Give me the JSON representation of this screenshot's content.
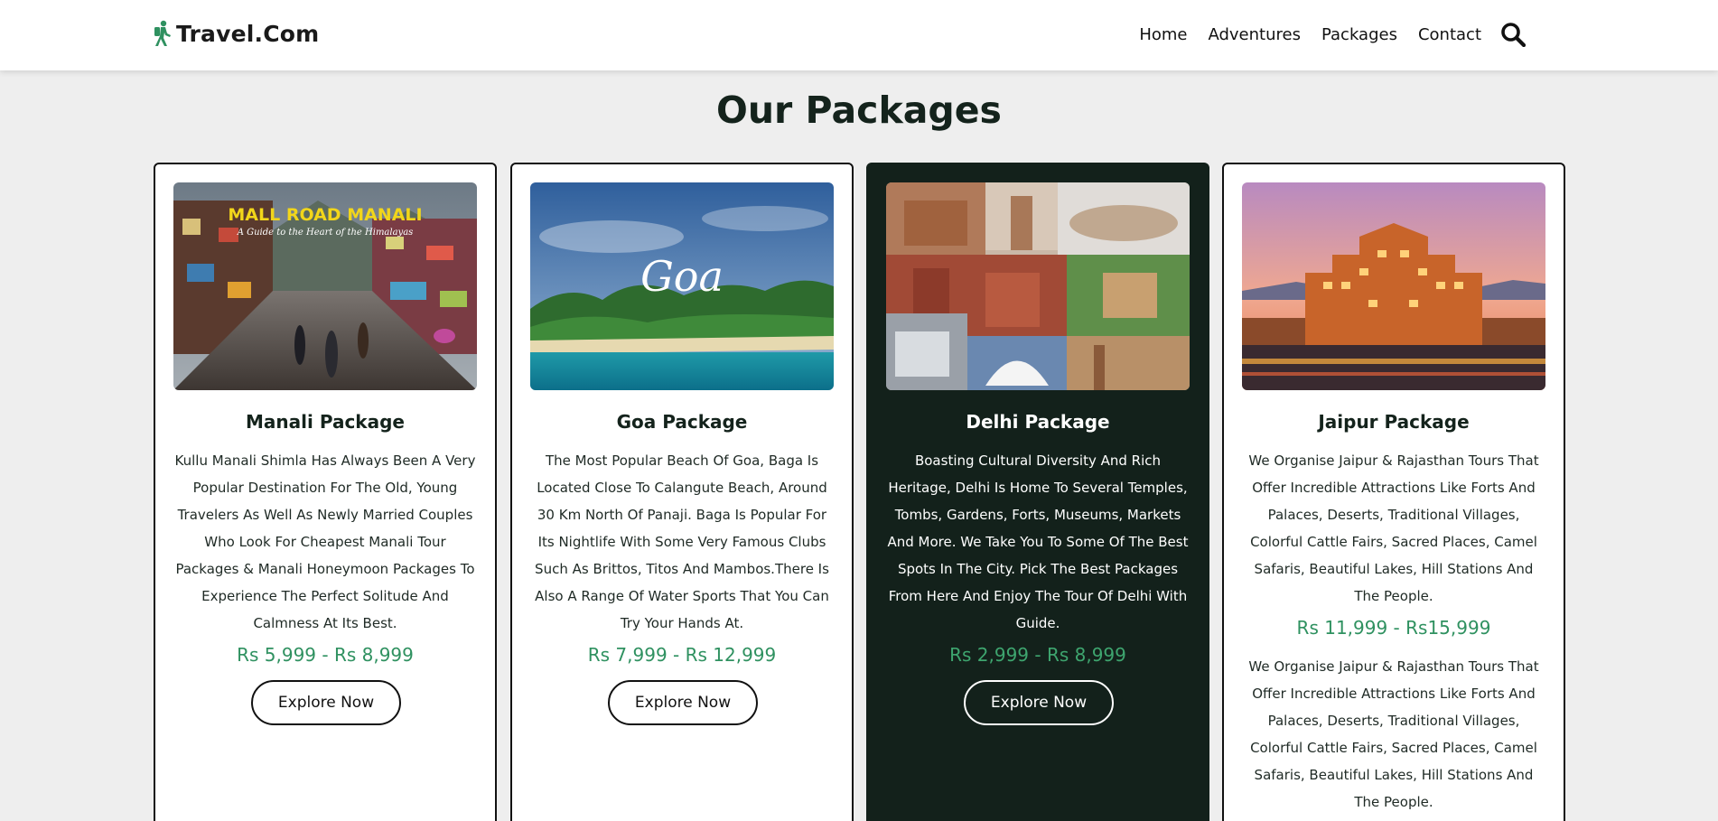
{
  "header": {
    "logo_text": "Travel.Com",
    "nav": [
      "Home",
      "Adventures",
      "Packages",
      "Contact"
    ]
  },
  "page_title": "Our Packages",
  "packages": [
    {
      "title": "Manali Package",
      "image_title": "MALL ROAD MANALI",
      "image_subtitle": "A Guide to the Heart of the Himalayas",
      "description": "Kullu Manali Shimla Has Always Been A Very Popular Destination For The Old, Young Travelers As Well As Newly Married Couples Who Look For Cheapest Manali Tour Packages & Manali Honeymoon Packages To Experience The Perfect Solitude And Calmness At Its Best.",
      "price": "Rs 5,999 - Rs 8,999",
      "button": "Explore Now"
    },
    {
      "title": "Goa Package",
      "image_title": "Goa",
      "description": "The Most Popular Beach Of Goa, Baga Is Located Close To Calangute Beach, Around 30 Km North Of Panaji. Baga Is Popular For Its Nightlife With Some Very Famous Clubs Such As Brittos, Titos And Mambos.There Is Also A Range Of Water Sports That You Can Try Your Hands At.",
      "price": "Rs 7,999 - Rs 12,999",
      "button": "Explore Now"
    },
    {
      "title": "Delhi Package",
      "description": "Boasting Cultural Diversity And Rich Heritage, Delhi Is Home To Several Temples, Tombs, Gardens, Forts, Museums, Markets And More. We Take You To Some Of The Best Spots In The City. Pick The Best Packages From Here And Enjoy The Tour Of Delhi With Guide.",
      "price": "Rs 2,999 - Rs 8,999",
      "button": "Explore Now"
    },
    {
      "title": "Jaipur Package",
      "description": "We Organise Jaipur & Rajasthan Tours That Offer Incredible Attractions Like Forts And Palaces, Deserts, Traditional Villages, Colorful Cattle Fairs, Sacred Places, Camel Safaris, Beautiful Lakes, Hill Stations And The People.",
      "price": "Rs 11,999 - Rs15,999",
      "description2": "We Organise Jaipur & Rajasthan Tours That Offer Incredible Attractions Like Forts And Palaces, Deserts, Traditional Villages, Colorful Cattle Fairs, Sacred Places, Camel Safaris, Beautiful Lakes, Hill Stations And The People."
    }
  ],
  "colors": {
    "accent_green": "#2f9160",
    "dark_card": "#13211b",
    "background": "#eeeeee"
  },
  "icons": [
    "hiker-icon",
    "search-icon"
  ]
}
